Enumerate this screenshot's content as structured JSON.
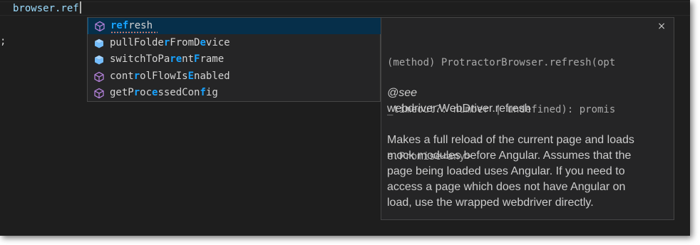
{
  "editor": {
    "code_text": "browser.ref",
    "below_char": ";"
  },
  "suggest": {
    "items": [
      {
        "label_parts": [
          [
            "re",
            1
          ],
          [
            "f",
            1
          ],
          [
            "resh",
            0
          ]
        ],
        "icon": "method-icon",
        "selected": true
      },
      {
        "label_parts": [
          [
            "pullFolde",
            0
          ],
          [
            "r",
            1
          ],
          [
            "FromD",
            0
          ],
          [
            "e",
            1
          ],
          [
            "vice",
            0
          ]
        ],
        "icon": "field-icon",
        "selected": false
      },
      {
        "label_parts": [
          [
            "switchToPa",
            0
          ],
          [
            "re",
            1
          ],
          [
            "nt",
            0
          ],
          [
            "F",
            1
          ],
          [
            "rame",
            0
          ]
        ],
        "icon": "field-icon",
        "selected": false
      },
      {
        "label_parts": [
          [
            "cont",
            0
          ],
          [
            "r",
            1
          ],
          [
            "olFlowIs",
            0
          ],
          [
            "E",
            1
          ],
          [
            "nabled",
            0
          ]
        ],
        "icon": "method-icon",
        "selected": false
      },
      {
        "label_parts": [
          [
            "getP",
            0
          ],
          [
            "r",
            1
          ],
          [
            "oc",
            0
          ],
          [
            "e",
            1
          ],
          [
            "ssedCon",
            0
          ],
          [
            "f",
            1
          ],
          [
            "ig",
            0
          ]
        ],
        "icon": "method-icon",
        "selected": false
      }
    ]
  },
  "details": {
    "signature_lines": [
      "(method) ProtractorBrowser.refresh(opt",
      "_timeout?: number | undefined): promis",
      "e.Promise<any>"
    ],
    "close_label": "×",
    "see_tag": "@see",
    "see_target": "webdriver.WebDriver.refresh",
    "description_lines": [
      "Makes a full reload of the current page and loads",
      "mock modules before Angular. Assumes that the",
      "page being loaded uses Angular. If you need to",
      "access a page which does not have Angular on",
      "load, use the wrapped webdriver directly."
    ]
  },
  "colors": {
    "editor_bg": "#1e1e1e",
    "widget_bg": "#252526",
    "selection_bg": "#062f4a",
    "match_highlight": "#18a3ff",
    "method_icon": "#b180d7",
    "field_icon": "#75beff"
  }
}
